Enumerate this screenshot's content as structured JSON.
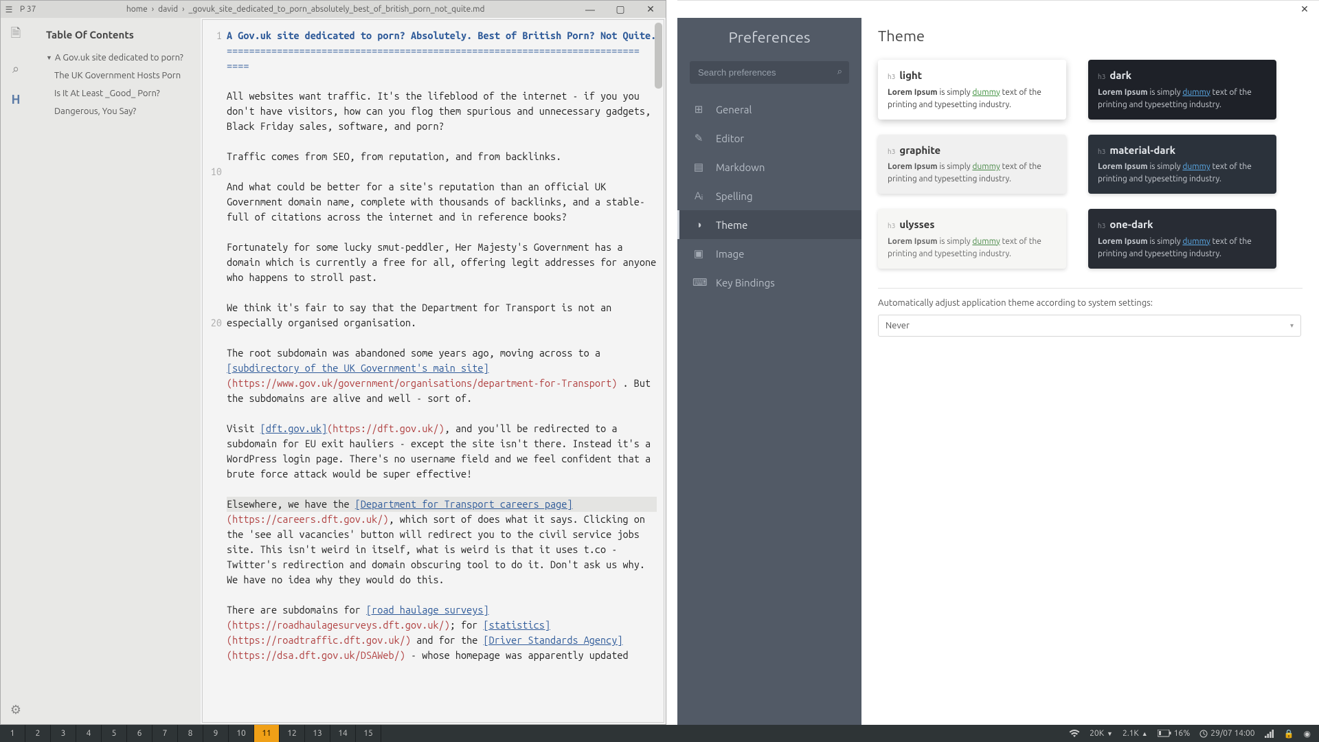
{
  "editor": {
    "projectLabel": "P 37",
    "crumbs": [
      "home",
      "david"
    ],
    "tabTitle": "_govuk_site_dedicated_to_porn_absolutely_best_of_british_porn_not_quite.md",
    "outline": {
      "title": "Table Of Contents",
      "root": "A Gov.uk site dedicated to porn?",
      "items": [
        "The UK Government Hosts Porn",
        "Is It At Least _Good_ Porn?",
        "Dangerous, You Say?"
      ]
    },
    "gutter": [
      "1",
      "",
      "",
      "",
      "",
      "",
      "",
      "",
      "",
      "10",
      "",
      "",
      "",
      "",
      "",
      "",
      "",
      "",
      "",
      "20",
      "",
      "",
      ""
    ],
    "doc": {
      "title": "A Gov.uk site dedicated to porn? Absolutely. Best of British Porn? Not Quite.",
      "rule": "==========================================================================\n====",
      "p1": "All websites want traffic. It's the lifeblood of the internet - if you you don't have visitors, how can you flog them spurious and unnecessary gadgets, Black Friday sales, software, and porn?",
      "p2": "Traffic comes from SEO, from reputation, and from backlinks.",
      "p3": "And what could be better for a site's reputation than an official UK Government domain name, complete with thousands of backlinks, and a stable-full of citations across the internet and in reference books?",
      "p4": "Fortunately for some lucky smut-peddler, Her Majesty's Government has a domain which is currently a free for all, offering legit addresses for anyone who happens to stroll past.",
      "p5": "We think it's fair to say that the Department for Transport is not an especially organised organisation.",
      "p6a": "The root subdomain was abandoned some years ago, moving across to a ",
      "l1t": "[subdirectory of the UK Government's main site]",
      "l1u": "(https://www.gov.uk/government/organisations/department-for-Transport)",
      "p6b": " . But the subdomains are alive and well - sort of.",
      "p7a": "Visit ",
      "l2t": "[dft.gov.uk]",
      "l2u": "(https://dft.gov.uk/)",
      "p7b": ", and you'll be redirected to a subdomain for EU exit hauliers - except the site isn't there. Instead it's a WordPress login page. There's no username field and we feel confident that a brute force attack would be super effective!",
      "p8a": "Elsewhere, we have the ",
      "l3t": "[Department for Transport careers page]",
      "l3u": "(https://careers.dft.gov.uk/)",
      "p8b": ", which sort of does what it says. Clicking on the 'see all vacancies' button will redirect you to the civil service jobs site. This isn't weird in itself, what is weird is that it uses t.co - Twitter's redirection and domain obscuring tool to do it. Don't ask us why. We have no idea why they would do this.",
      "p9a": "There are subdomains for ",
      "l4t": "[road haulage surveys]",
      "l4u": "(https://roadhaulagesurveys.dft.gov.uk/)",
      "p9b": "; for ",
      "l5t": "[statistics]",
      "l5u": "(https://roadtraffic.dft.gov.uk/)",
      "p9c": " and for the ",
      "l6t": "[Driver Standards Agency]",
      "l6u": "(https://dsa.dft.gov.uk/DSAWeb/)",
      "p9d": " - whose homepage was apparently updated"
    }
  },
  "preferences": {
    "title": "Preferences",
    "searchPlaceholder": "Search preferences",
    "nav": [
      {
        "icon": "⊞",
        "label": "General"
      },
      {
        "icon": "✎",
        "label": "Editor"
      },
      {
        "icon": "▤",
        "label": "Markdown"
      },
      {
        "icon": "Aᵢ",
        "label": "Spelling"
      },
      {
        "icon": "◑",
        "label": "Theme"
      },
      {
        "icon": "▣",
        "label": "Image"
      },
      {
        "icon": "⌨",
        "label": "Key Bindings"
      }
    ],
    "section": "Theme",
    "sample": {
      "pre": "Lorem Ipsum",
      "mid": " is simply ",
      "link": "dummy",
      "post": " text of the printing and typesetting industry."
    },
    "themes": [
      {
        "name": "light",
        "cls": "tc-light"
      },
      {
        "name": "dark",
        "cls": "tc-dark"
      },
      {
        "name": "graphite",
        "cls": "tc-graphite"
      },
      {
        "name": "material-dark",
        "cls": "tc-material"
      },
      {
        "name": "ulysses",
        "cls": "tc-ulysses"
      },
      {
        "name": "one-dark",
        "cls": "tc-onedark"
      }
    ],
    "autoLabel": "Automatically adjust application theme according to system settings:",
    "autoValue": "Never"
  },
  "taskbar": {
    "buttons": [
      "1",
      "2",
      "3",
      "4",
      "5",
      "6",
      "7",
      "8",
      "9",
      "10",
      "11",
      "12",
      "13",
      "14",
      "15"
    ],
    "active": "11",
    "tray": {
      "down": "20K",
      "up": "2.1K",
      "battery": "16%",
      "datetime": "29/07 14:00"
    }
  }
}
